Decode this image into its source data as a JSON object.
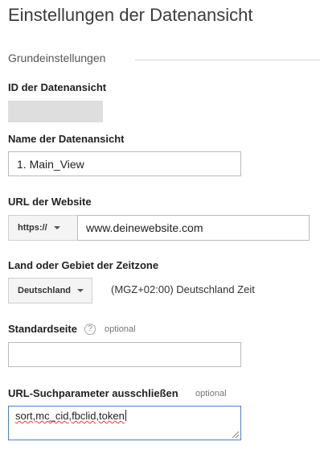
{
  "page": {
    "title": "Einstellungen der Datenansicht"
  },
  "section": {
    "label": "Grundeinstellungen"
  },
  "view_id": {
    "label": "ID der Datenansicht"
  },
  "view_name": {
    "label": "Name der Datenansicht",
    "value": "1. Main_View"
  },
  "website_url": {
    "label": "URL der Website",
    "protocol": "https://",
    "value": "www.deinewebsite.com"
  },
  "timezone": {
    "label": "Land oder Gebiet der Zeitzone",
    "country": "Deutschland",
    "zone_text": "(MGZ+02:00) Deutschland Zeit"
  },
  "default_page": {
    "label": "Standardseite",
    "help_symbol": "?",
    "optional": "optional",
    "value": ""
  },
  "exclude_params": {
    "label": "URL-Suchparameter ausschließen",
    "optional": "optional",
    "value": "sort,mc_cid,fbclid,token"
  },
  "icons": {
    "help": "help-circle-icon",
    "dropdown": "chevron-down-icon",
    "resize": "resize-grip-icon"
  },
  "colors": {
    "focus_border": "#4a7fd0",
    "spellcheck": "#e53935"
  }
}
